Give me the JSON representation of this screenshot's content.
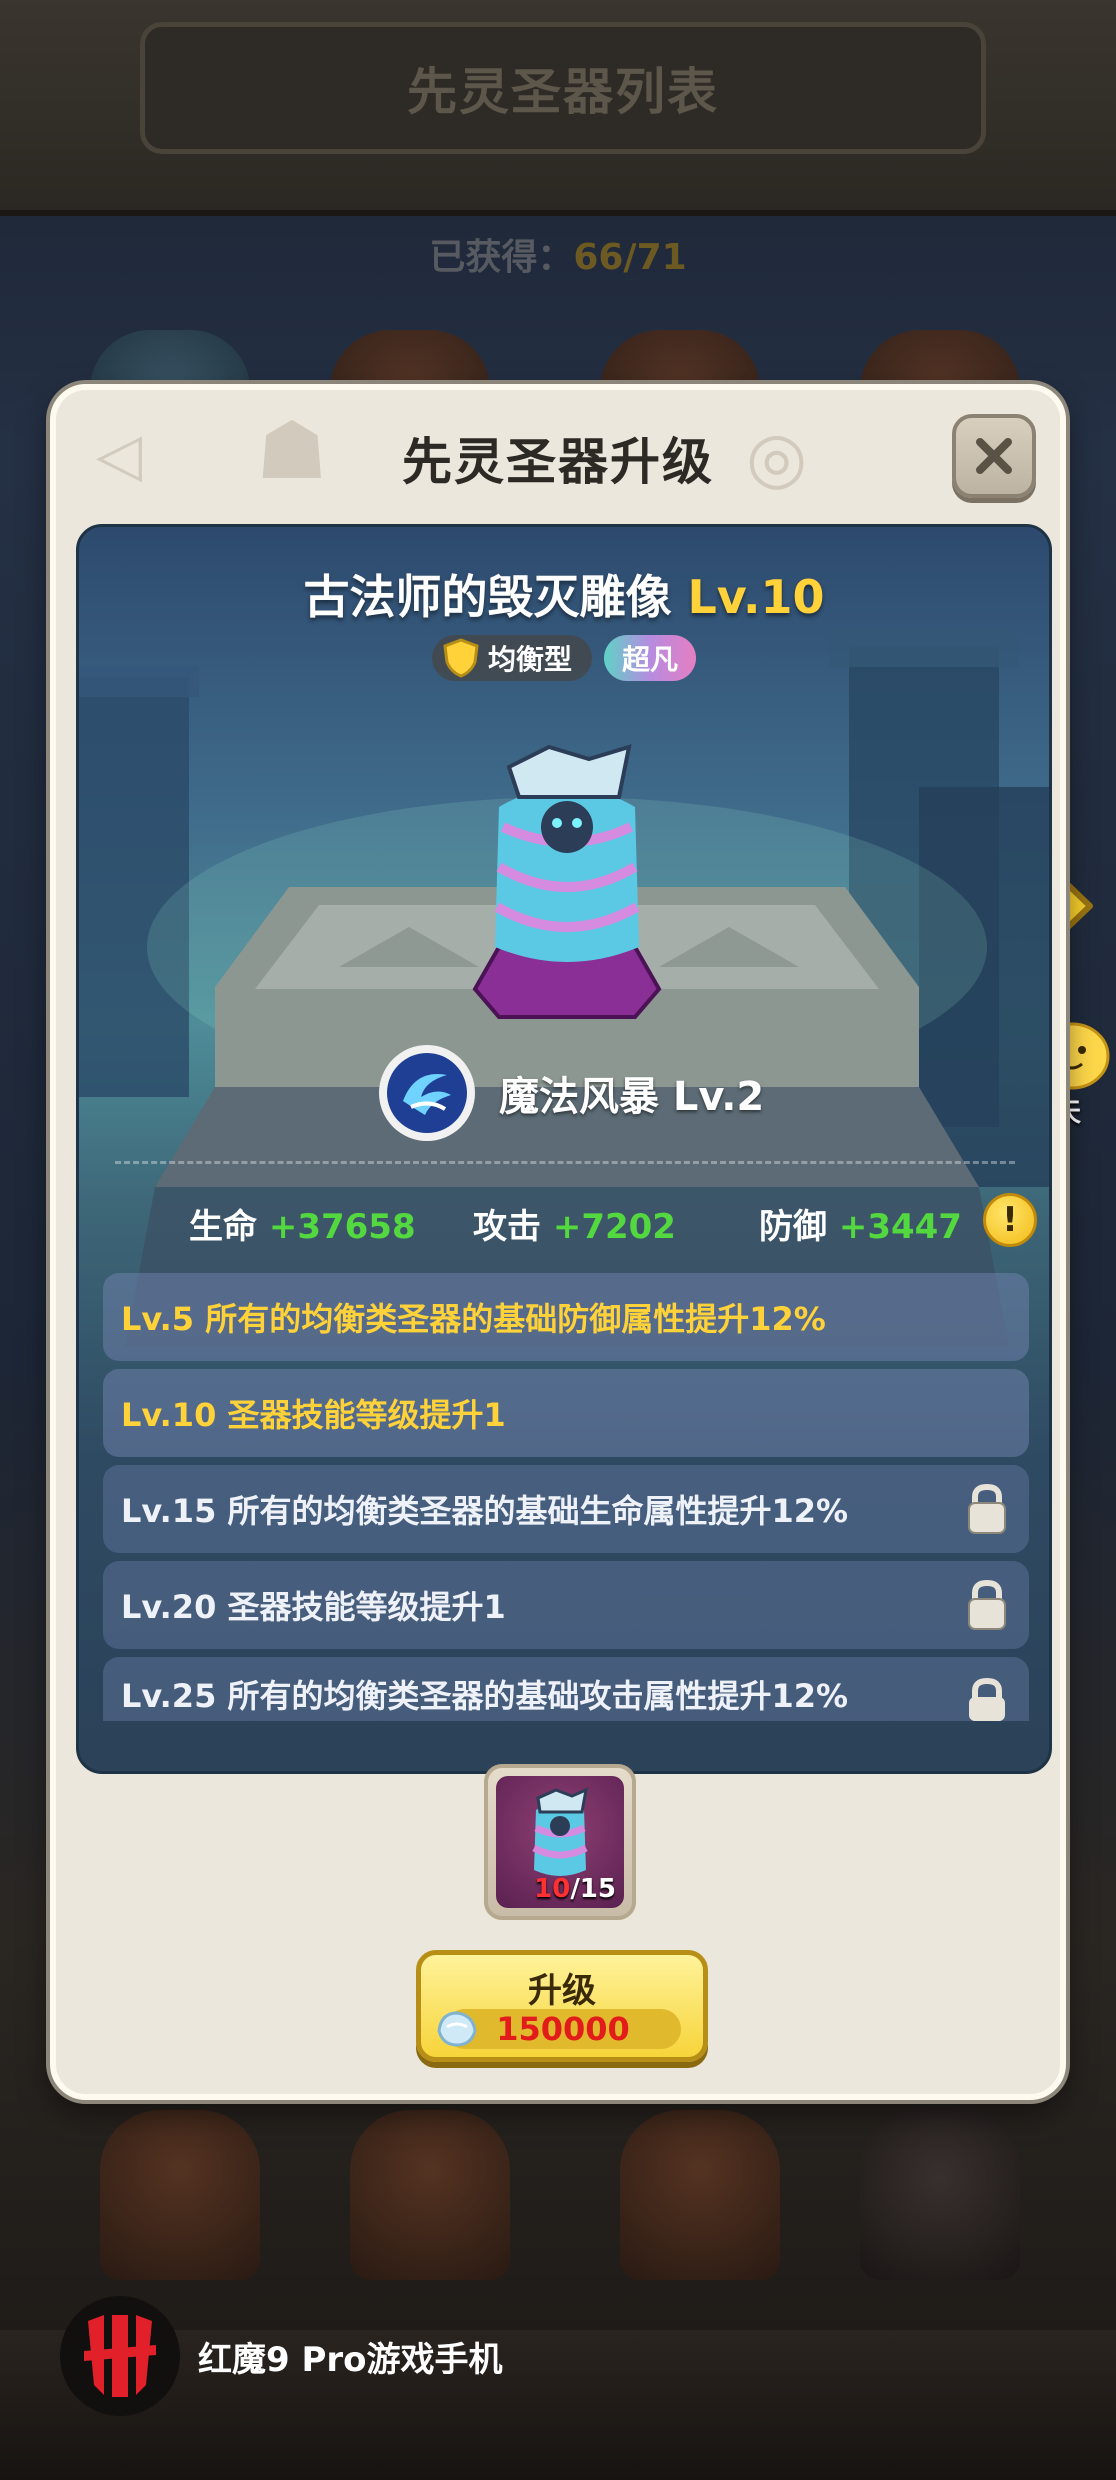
{
  "background": {
    "title": "先灵圣器列表",
    "obtained_label": "已获得：",
    "obtained_value": "66/71"
  },
  "dialog": {
    "title": "先灵圣器升级",
    "close_icon": "close-icon"
  },
  "artifact": {
    "name": "古法师的毁灭雕像",
    "level": "Lv.10",
    "type_tag": "均衡型",
    "rarity_tag": "超凡",
    "skill_name": "魔法风暴 Lv.2"
  },
  "stats": [
    {
      "label": "生命",
      "value": "+37658"
    },
    {
      "label": "攻击",
      "value": "+7202"
    },
    {
      "label": "防御",
      "value": "+3447"
    }
  ],
  "info_icon_glyph": "!",
  "bonuses": [
    {
      "text": "Lv.5 所有的均衡类圣器的基础防御属性提升12%",
      "unlocked": true
    },
    {
      "text": "Lv.10 圣器技能等级提升1",
      "unlocked": true
    },
    {
      "text": "Lv.15 所有的均衡类圣器的基础生命属性提升12%",
      "unlocked": false
    },
    {
      "text": "Lv.20 圣器技能等级提升1",
      "unlocked": false
    },
    {
      "text": "Lv.25 所有的均衡类圣器的基础攻击属性提升12%",
      "unlocked": false
    }
  ],
  "fragments": {
    "current": "10",
    "total": "/15"
  },
  "upgrade": {
    "label": "升级",
    "cost": "150000"
  },
  "side": {
    "chat_label": "聊天"
  },
  "brand": {
    "text": "红魔9 Pro游戏手机"
  },
  "colors": {
    "active_bonus": "#ffd23a",
    "stat_value": "#54d83f",
    "cost_text": "#e21b1b",
    "fragment_current": "#ff3030"
  }
}
